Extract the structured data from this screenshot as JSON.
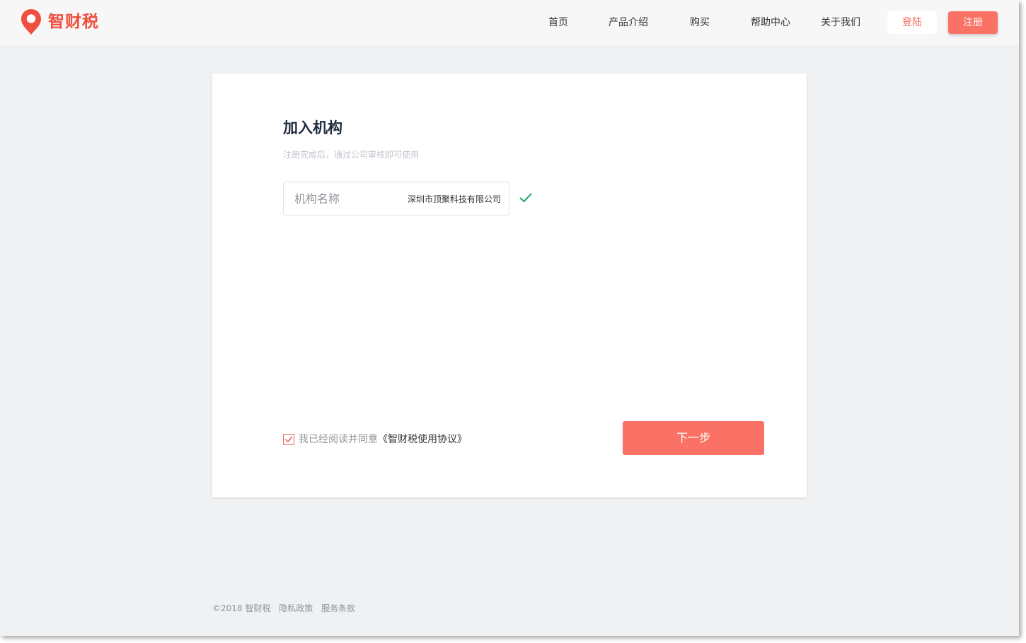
{
  "brand": {
    "name": "智财税",
    "color": "#f04e3e",
    "icon": "location-pin-icon"
  },
  "nav": {
    "items": [
      {
        "label": "首页"
      },
      {
        "label": "产品介绍"
      },
      {
        "label": "购买"
      },
      {
        "label": "帮助中心"
      },
      {
        "label": "关于我们"
      }
    ],
    "login_label": "登陆",
    "register_label": "注册"
  },
  "form": {
    "title": "加入机构",
    "subtitle": "注册完成后，通过公司审核即可使用",
    "org_field": {
      "label": "机构名称",
      "value": "深圳市顶聚科技有限公司",
      "validated": true,
      "status_icon": "check-icon"
    },
    "agreement": {
      "checked": true,
      "text": "我已经阅读并同意",
      "link": "《智财税使用协议》"
    },
    "next_label": "下一步"
  },
  "footer": {
    "copyright": "©2018 智财税",
    "privacy": "隐私政策",
    "terms": "服务条款"
  },
  "colors": {
    "accent": "#fa7265",
    "success": "#1aab63",
    "page_bg": "#f0f1f2"
  }
}
